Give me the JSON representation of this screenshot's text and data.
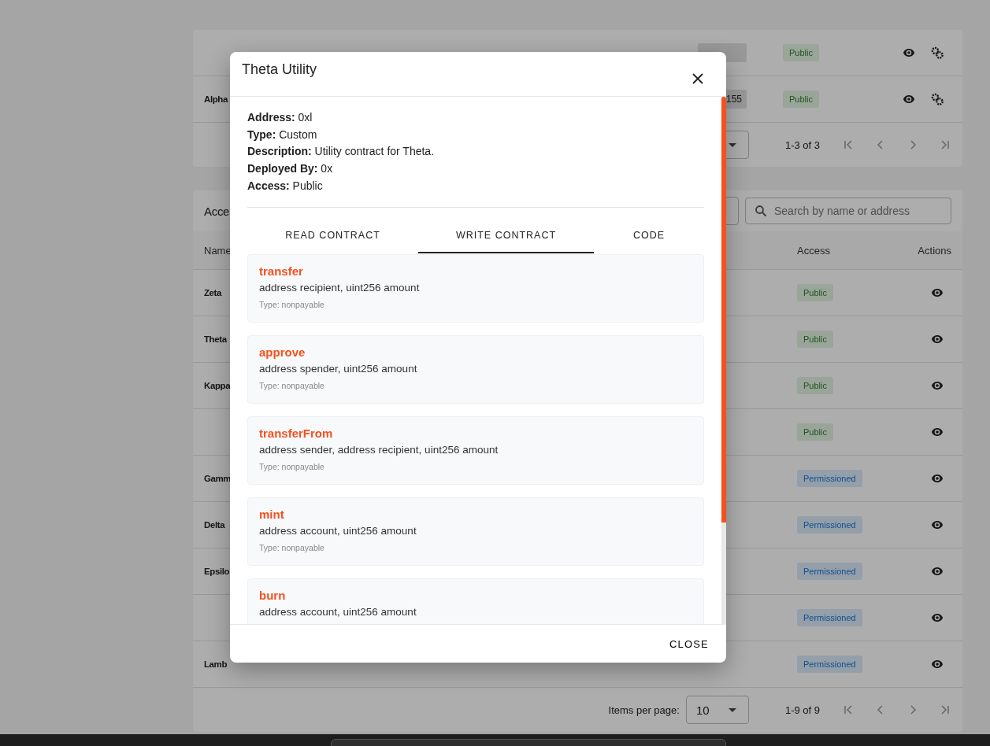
{
  "upper_table": {
    "rows": [
      {
        "access": "Public",
        "kind": "public"
      },
      {
        "name": "Alpha",
        "standard": "155",
        "access": "Public",
        "kind": "public"
      }
    ],
    "pagination": {
      "range": "1-3 of 3"
    }
  },
  "lower_table": {
    "title": "Acce",
    "search": {
      "placeholder": "Search by name or address"
    },
    "columns": [
      {
        "label": "Name",
        "kind": "name"
      },
      {
        "label": "Access",
        "kind": "access"
      },
      {
        "label": "Actions",
        "kind": "actions"
      }
    ],
    "rows": [
      {
        "name": "Zeta",
        "access": "Public",
        "kind": "public"
      },
      {
        "name": "Theta",
        "access": "Public",
        "kind": "public"
      },
      {
        "name": "Kappa",
        "access": "Public",
        "kind": "public"
      },
      {
        "access": "Public",
        "kind": "public"
      },
      {
        "name": "Gamm",
        "access": "Permissioned",
        "kind": "permissioned"
      },
      {
        "name": "Delta",
        "access": "Permissioned",
        "kind": "permissioned"
      },
      {
        "name": "Epsilo",
        "access": "Permissioned",
        "kind": "permissioned"
      },
      {
        "access": "Permissioned",
        "kind": "permissioned"
      },
      {
        "name": "Lamb",
        "access": "Permissioned",
        "kind": "permissioned"
      }
    ],
    "pagination": {
      "label": "Items per page:",
      "per_page": "10",
      "range": "1-9 of 9"
    }
  },
  "modal": {
    "title": "Theta Utility",
    "details": [
      "**Address:** 0xl",
      "**Type:** Custom",
      "**Description:** Utility contract for Theta.",
      "**Deployed By:** 0x",
      "**Access:** Public"
    ],
    "tabs": [
      {
        "label": "READ CONTRACT",
        "selected": false
      },
      {
        "label": "WRITE CONTRACT",
        "selected": true
      },
      {
        "label": "CODE",
        "selected": false
      }
    ],
    "functions": [
      {
        "name": "transfer",
        "params": "address recipient, uint256 amount",
        "type_line": "Type: nonpayable"
      },
      {
        "name": "approve",
        "params": "address spender, uint256 amount",
        "type_line": "Type: nonpayable"
      },
      {
        "name": "transferFrom",
        "params": "address sender, address recipient, uint256 amount",
        "type_line": "Type: nonpayable"
      },
      {
        "name": "mint",
        "params": "address account, uint256 amount",
        "type_line": "Type: nonpayable"
      },
      {
        "name": "burn",
        "params": "address account, uint256 amount"
      }
    ],
    "close_button": "CLOSE"
  }
}
